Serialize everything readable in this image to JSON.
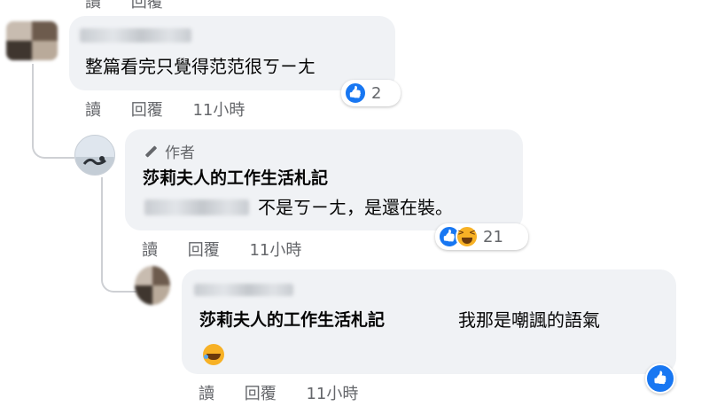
{
  "top_meta": {
    "reply": "讀",
    "reply2": "回覆"
  },
  "comment1": {
    "text": "整篇看完只覺得范范很ㄎㄧㄤ",
    "reactions": {
      "count": "2"
    },
    "actions": {
      "reply": "讀",
      "reply_full": "回覆",
      "time": "11小時"
    }
  },
  "comment2": {
    "badge": "作者",
    "author": "莎莉夫人的工作生活札記",
    "text": "不是ㄎㄧㄤ，是還在裝。",
    "reactions": {
      "count": "21"
    },
    "actions": {
      "reply": "讀",
      "reply_full": "回覆",
      "time": "11小時"
    }
  },
  "comment3": {
    "mention": "莎莉夫人的工作生活札記",
    "text": "我那是嘲諷的語氣",
    "actions": {
      "reply": "讀",
      "reply_full": "回覆",
      "time": "11小時"
    }
  },
  "colors": {
    "bubble": "#f0f2f5",
    "like": "#1877f2",
    "haha": "#f7b125",
    "meta": "#65676b"
  }
}
